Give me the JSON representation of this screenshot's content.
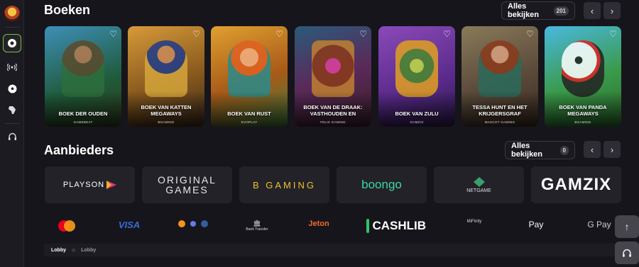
{
  "sections": {
    "books_title": "Boeken",
    "books_view_all": "Alles bekijken",
    "books_count": "201",
    "providers_title": "Aanbieders",
    "providers_view_all": "Alles bekijken",
    "providers_count": "0"
  },
  "games": [
    {
      "name": "BOEK DER OUDEN",
      "provider": "GAMEBEAT"
    },
    {
      "name": "BOEK VAN KATTEN MEGAWAYS",
      "provider": "BGAMING"
    },
    {
      "name": "BOEK VAN RUST",
      "provider": "EVOPLAY"
    },
    {
      "name": "BOEK VAN DE DRAAK: VASTHOUDEN EN",
      "provider": "FELIX GAMING"
    },
    {
      "name": "BOEK VAN ZULU",
      "provider": "GAMZIX"
    },
    {
      "name": "TESSA HUNT EN HET KRIJGERSGRAF",
      "provider": "MASCOT GAMING"
    },
    {
      "name": "BOEK VAN PANDA MEGAWAYS",
      "provider": "BGAMING"
    }
  ],
  "providers": [
    "PLAYSON",
    "ORIGINAL GAMES",
    "B GAMING",
    "boongo",
    "NETGAME",
    "GAMZIX"
  ],
  "payments": [
    "mastercard",
    "VISA",
    "crypto",
    "Bank Transfer",
    "Jeton",
    "CASHLIB",
    "MiFinity",
    "Pay",
    "G Pay"
  ],
  "breadcrumb": {
    "first": "Lobby",
    "second": "Lobby"
  },
  "colors": {
    "accent": "#7fbf3a",
    "background": "#16151b",
    "tile": "#232229"
  }
}
